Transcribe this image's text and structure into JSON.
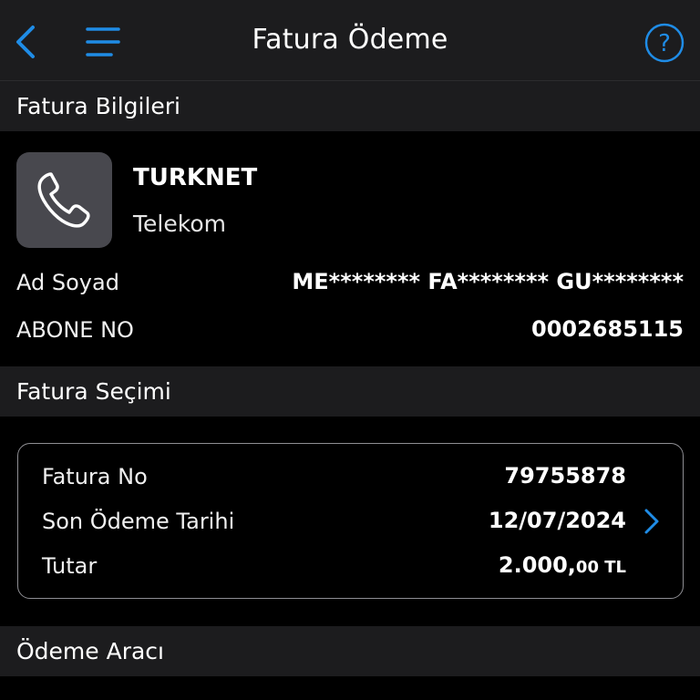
{
  "header": {
    "title": "Fatura Ödeme",
    "back_icon": "chevron-left-icon",
    "menu_icon": "hamburger-menu-icon",
    "help_icon": "question-circle-icon",
    "accent_color": "#1f8ce6"
  },
  "bill_info": {
    "section_title": "Fatura Bilgileri",
    "provider": {
      "icon": "phone-icon",
      "name": "TURKNET",
      "category": "Telekom"
    },
    "name_label": "Ad Soyad",
    "name_value": "ME******** FA******** GU********",
    "subscriber_label": "ABONE NO",
    "subscriber_value": "0002685115"
  },
  "bill_selection": {
    "section_title": "Fatura Seçimi",
    "bill_no_label": "Fatura No",
    "bill_no_value": "79755878",
    "due_date_label": "Son Ödeme Tarihi",
    "due_date_value": "12/07/2024",
    "amount_label": "Tutar",
    "amount_main": "2.000,",
    "amount_cents_currency": "00 TL"
  },
  "payment_method": {
    "section_title": "Ödeme Aracı"
  }
}
